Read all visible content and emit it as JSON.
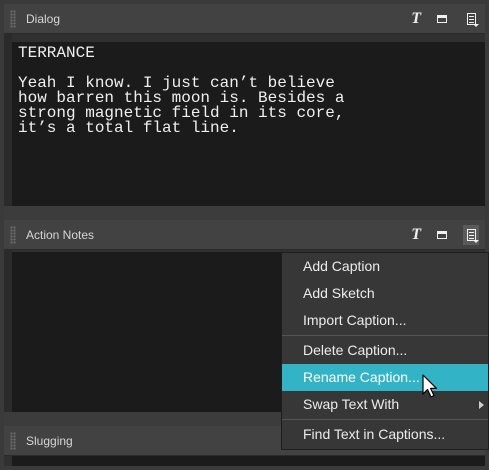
{
  "panels": {
    "dialog": {
      "title": "Dialog",
      "content": "TERRANCE\n\nYeah I know. I just can’t believe\nhow barren this moon is. Besides a\nstrong magnetic field in its core,\nit’s a total flat line."
    },
    "action_notes": {
      "title": "Action Notes",
      "content": ""
    },
    "slugging": {
      "title": "Slugging"
    }
  },
  "header_icons": {
    "text_tool": "T"
  },
  "context_menu": {
    "items": [
      {
        "label": "Add Caption"
      },
      {
        "label": "Add Sketch"
      },
      {
        "label": "Import Caption..."
      },
      {
        "label": "Delete Caption..."
      },
      {
        "label": "Rename Caption..."
      },
      {
        "label": "Swap Text With"
      },
      {
        "label": "Find Text in Captions..."
      }
    ],
    "highlight_color": "#33b3c6"
  }
}
